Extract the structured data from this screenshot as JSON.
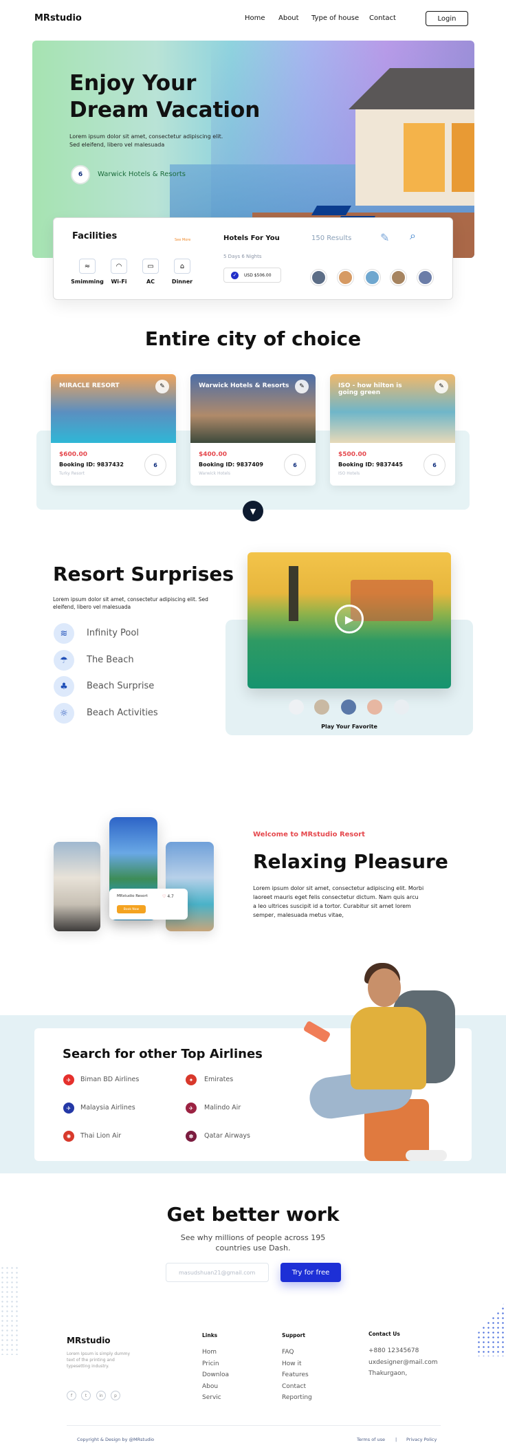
{
  "nav": {
    "brand": "MRstudio",
    "links": [
      "Home",
      "About",
      "Type of house",
      "Contact"
    ],
    "login": "Login"
  },
  "hero": {
    "title_line1": "Enjoy Your",
    "title_line2": "Dream Vacation",
    "text_line1": "Lorem ipsum dolor sit amet, consectetur adipiscing elit.",
    "text_line2": "Sed eleifend, libero vel malesuada",
    "logo_mark": "6",
    "logo_name": "Warwick Hotels & Resorts"
  },
  "facilities": {
    "title": "Facilities",
    "see_more": "See More",
    "items": [
      {
        "label": "Smimming",
        "icon": "pool-icon",
        "glyph": "≈"
      },
      {
        "label": "Wi-Fi",
        "icon": "wifi-icon",
        "glyph": "◠"
      },
      {
        "label": "AC",
        "icon": "ac-icon",
        "glyph": "▭"
      },
      {
        "label": "Dinner",
        "icon": "dinner-icon",
        "glyph": "⌂"
      }
    ],
    "hotels_for_you": "Hotels For You",
    "results": "150 Results",
    "days": "5 Days 6 Nights",
    "price": "USD $506.00",
    "thumb_colors": [
      "#5c6d86",
      "#d69a63",
      "#6fa7cf",
      "#a68460",
      "#6b7da8"
    ]
  },
  "city": {
    "title": "Entire city of choice",
    "cards": [
      {
        "name": "MIRACLE RESORT",
        "price": "$600.00",
        "booking": "Booking ID: 9837432",
        "sub": "Turky Resort",
        "logo": "6",
        "img_top": "#f0a45a",
        "img_mid": "#5b8fc0",
        "img_bot": "#2fb7d6"
      },
      {
        "name": "Warwick Hotels & Resorts",
        "price": "$400.00",
        "booking": "Booking ID: 9837409",
        "sub": "Warwick Hotels",
        "logo": "6",
        "img_top": "#4c6ea8",
        "img_mid": "#b08a6a",
        "img_bot": "#3d4a3c"
      },
      {
        "name": "ISO - how hilton is going green",
        "price": "$500.00",
        "booking": "Booking ID: 9837445",
        "sub": "ISO Hotels",
        "logo": "6",
        "img_top": "#f1b86a",
        "img_mid": "#6fb6c9",
        "img_bot": "#e7d9b8"
      }
    ]
  },
  "resort": {
    "title": "Resort Surprises",
    "text_line1": "Lorem ipsum dolor sit amet, consectetur adipiscing elit. Sed",
    "text_line2": "eleifend, libero vel malesuada",
    "features": [
      {
        "label": "Infinity Pool",
        "icon": "swimmer-icon",
        "glyph": "≋"
      },
      {
        "label": "The Beach",
        "icon": "umbrella-icon",
        "glyph": "☂"
      },
      {
        "label": "Beach Surprise",
        "icon": "palm-icon",
        "glyph": "♣"
      },
      {
        "label": "Beach Activities",
        "icon": "sunset-icon",
        "glyph": "☼"
      }
    ],
    "play_caption": "Play Your Favorite",
    "dot_colors": [
      "#eef1f4",
      "#c9b9a3",
      "#5a78a8",
      "#e7b7a2",
      "#e9eef2"
    ]
  },
  "pleasure": {
    "kicker": "Welcome to MRstudio Resort",
    "title": "Relaxing Pleasure",
    "text_line1": "Lorem ipsum dolor sit amet, consectetur adipiscing elit. Morbi",
    "text_line2": "laoreet mauris eget felis consectetur dictum. Nam quis arcu",
    "text_line3": "a leo ultrices suscipit id a tortor. Curabitur sit amet lorem",
    "text_line4": "semper, malesuada metus vitae,",
    "popup_name": "MRstudio Resort",
    "popup_rating": "4.7",
    "popup_button": "Book Now"
  },
  "airlines": {
    "title": "Search for other Top Airlines",
    "items": [
      {
        "label": "Biman BD Airlines",
        "color": "#e5302c",
        "glyph": "✈"
      },
      {
        "label": "Emirates",
        "color": "#d8382b",
        "glyph": "✦"
      },
      {
        "label": "Malaysia Airlines",
        "color": "#2438a6",
        "glyph": "✈"
      },
      {
        "label": "Malindo Air",
        "color": "#9b2242",
        "glyph": "✈"
      },
      {
        "label": "Thai Lion Air",
        "color": "#d83a2c",
        "glyph": "✺"
      },
      {
        "label": "Qatar Airways",
        "color": "#7b1c3f",
        "glyph": "✽"
      }
    ]
  },
  "cta": {
    "title": "Get better work",
    "sub_line1": "See why millions of people across 195",
    "sub_line2": "countries use Dash.",
    "email_placeholder": "masudshuan21@gmail.com",
    "button": "Try for free"
  },
  "footer": {
    "brand": "MRstudio",
    "desc_line1": "Lorem Ipsum is simply dummy",
    "desc_line2": "text of the printing and",
    "desc_line3": "typesetting industry.",
    "social": [
      "f",
      "t",
      "in",
      "p"
    ],
    "links_title": "Links",
    "links": [
      "Hom",
      "Pricin",
      "Downloa",
      "Abou",
      "Servic"
    ],
    "support_title": "Support",
    "support": [
      "FAQ",
      "How it",
      "Features",
      "Contact",
      "Reporting"
    ],
    "contact_title": "Contact Us",
    "contact": [
      "+880 12345678",
      "uxdesigner@mail.com",
      "Thakurgaon,"
    ],
    "copyright": "Copyright & Design by @MRstudio",
    "terms": "Terms of use",
    "divider": "|",
    "privacy": "Privacy  Policy"
  }
}
